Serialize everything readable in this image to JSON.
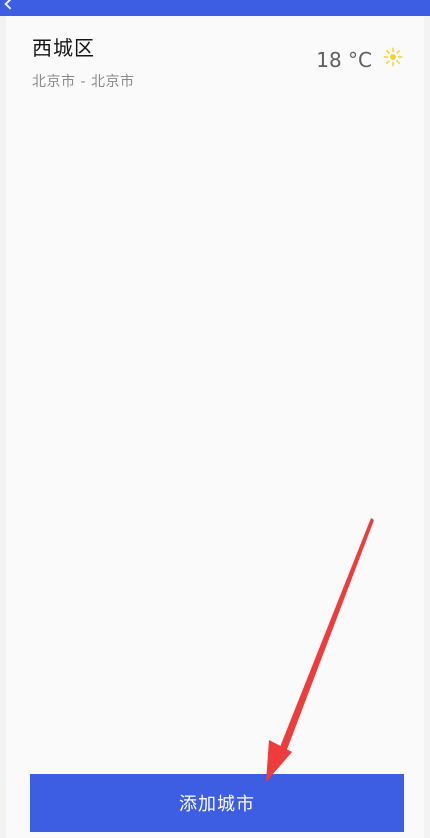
{
  "city": {
    "name": "西城区",
    "region": "北京市 - 北京市",
    "temperature": "18 °C",
    "weather_icon": "sun-icon"
  },
  "actions": {
    "add_city_label": "添加城市"
  },
  "colors": {
    "accent": "#3d5de3",
    "arrow": "#ee3b3b",
    "sun": "#f5d51a"
  }
}
